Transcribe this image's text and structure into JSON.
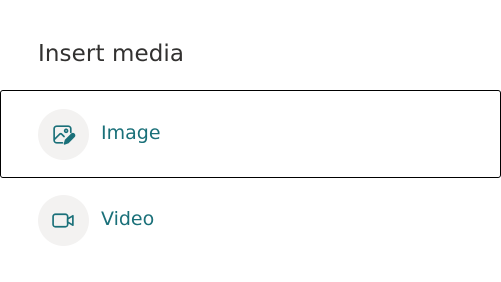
{
  "dialog": {
    "title": "Insert media",
    "options": [
      {
        "label": "Image",
        "icon": "image-edit-icon",
        "focused": true
      },
      {
        "label": "Video",
        "icon": "video-camera-icon",
        "focused": false
      }
    ]
  },
  "colors": {
    "accent": "#1a7079",
    "title_text": "#323130",
    "icon_circle_bg": "#f3f2f1",
    "focus_border": "#000000"
  }
}
